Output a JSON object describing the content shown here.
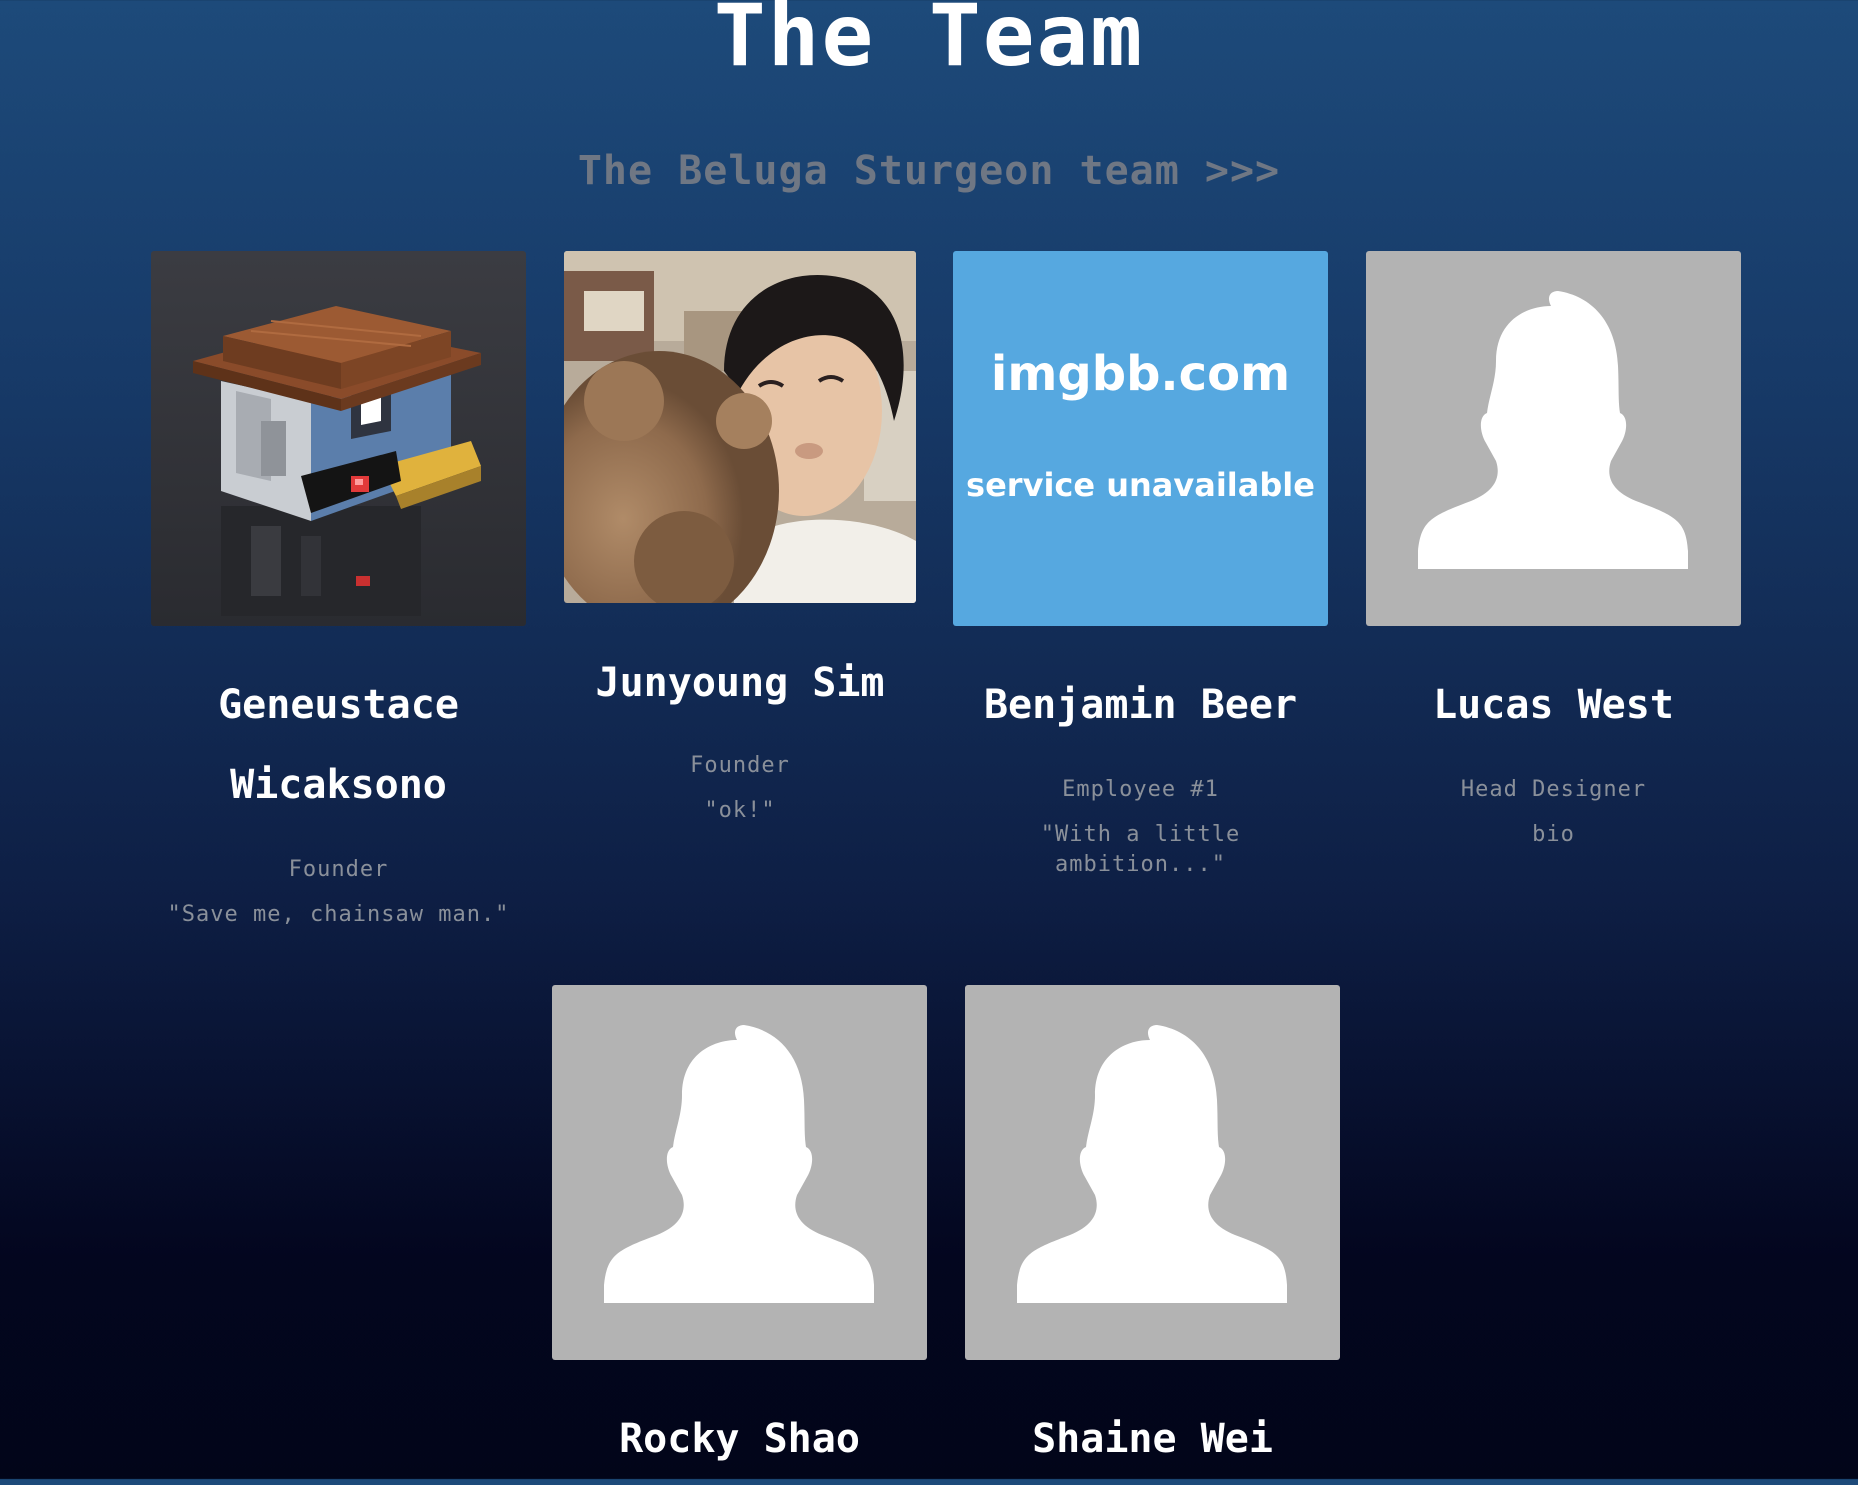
{
  "header": {
    "title": "The Team",
    "subtitle": "The Beluga Sturgeon team >>>"
  },
  "colors": {
    "accent_blue": "#56a8e0",
    "placeholder_gray": "#b3b3b3",
    "muted_text": "#8a909a"
  },
  "members": [
    {
      "name_line1": "Geneustace",
      "name_line2": "Wicaksono",
      "role": "Founder",
      "bio": "\"Save me, chainsaw man.\"",
      "photo": "voxel-character-render"
    },
    {
      "name_line1": "Junyoung Sim",
      "role": "Founder",
      "bio": "\"ok!\"",
      "photo": "selfie-with-dog"
    },
    {
      "name_line1": "Benjamin Beer",
      "role": "Employee #1",
      "bio": "\"With a little ambition...\"",
      "photo": "imgbb-placeholder",
      "photo_title": "imgbb.com",
      "photo_subtitle": "service unavailable"
    },
    {
      "name_line1": "Lucas West",
      "role": "Head Designer",
      "bio": "bio",
      "photo": "default-avatar"
    },
    {
      "name_line1": "Rocky Shao",
      "photo": "default-avatar"
    },
    {
      "name_line1": "Shaine Wei",
      "photo": "default-avatar"
    }
  ]
}
